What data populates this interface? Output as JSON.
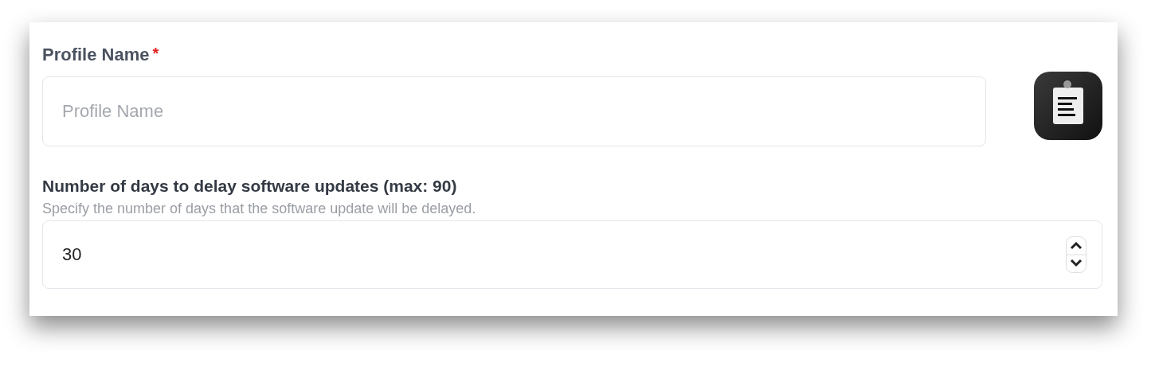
{
  "profile_name": {
    "label": "Profile Name",
    "required_mark": "*",
    "placeholder": "Profile Name"
  },
  "delay_days": {
    "label": "Number of days to delay software updates (max: 90)",
    "help": "Specify the number of days that the software update will be delayed.",
    "value": "30"
  }
}
